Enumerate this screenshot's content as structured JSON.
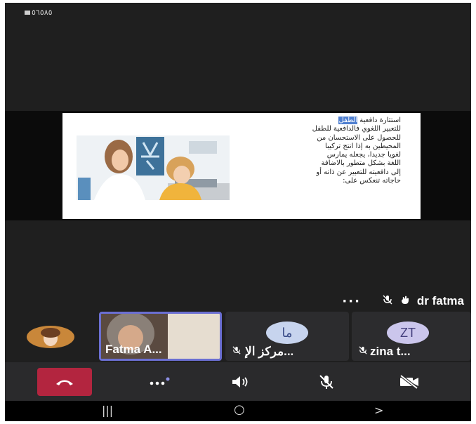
{
  "status_bar": {
    "text": "٥٦٥٨٥"
  },
  "slide": {
    "lines": [
      "استثارة دافعية الطفل",
      "للتعبير اللغوي فالدافعية للطفل",
      "للحصول على الاستحسان من",
      "المحيطين به إذا انتج تركيبا",
      "لغويا جديدا، يجعله يمارس",
      "اللغة بشكل متطور بالاضافة",
      "إلى دافعيته للتعبير عن ذاته أو",
      "حاجاته تنعكس على:"
    ],
    "highlight": "الطفل"
  },
  "active_speaker": {
    "name": "dr fatma"
  },
  "participants": [
    {
      "id": "p1",
      "label": "",
      "avatar": "photo"
    },
    {
      "id": "p2",
      "label": "Fatma A...",
      "avatar": "video"
    },
    {
      "id": "p3",
      "label": "مركز الإ...",
      "avatar_text": "ما",
      "avatar_color": "#c7d4ee"
    },
    {
      "id": "p4",
      "label": "zina t...",
      "avatar_text": "ZT",
      "avatar_color": "#cbc6ec"
    }
  ],
  "controls": {
    "hangup_icon": "phone-hangup-icon",
    "more_icon": "more-options-icon",
    "speaker_icon": "speaker-icon",
    "mic_icon": "mic-off-icon",
    "camera_icon": "camera-off-icon"
  },
  "nav": {
    "recents": "|||",
    "home": "○",
    "back": ">"
  },
  "colors": {
    "hangup": "#b3253f",
    "active_tile": "#6b6fd2"
  }
}
